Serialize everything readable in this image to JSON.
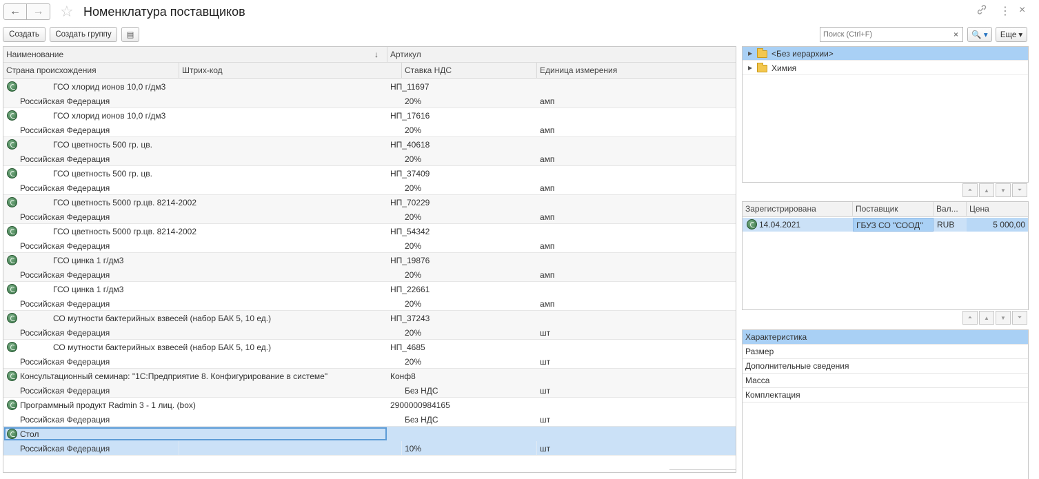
{
  "window": {
    "title": "Номенклатура поставщиков",
    "back_icon": "←",
    "forward_icon": "→",
    "star_icon": "☆",
    "link_icon": "🔗",
    "menu_icon": "⋮",
    "close_icon": "×"
  },
  "toolbar": {
    "create_label": "Создать",
    "create_group_label": "Создать группу",
    "list_icon": "▤",
    "search_placeholder": "Поиск (Ctrl+F)",
    "search_clear": "×",
    "search_btn": "🔍 ▾",
    "more_label": "Еще ▾"
  },
  "table": {
    "headers": {
      "name": "Наименование",
      "sort_arrow": "↓",
      "article": "Артикул",
      "country": "Страна происхождения",
      "barcode": "Штрих-код",
      "vat": "Ставка НДС",
      "unit": "Единица измерения"
    },
    "rows": [
      {
        "name": "ГСО хлорид ионов  10,0 г/дм3",
        "indent": true,
        "article": "НП_11697",
        "country": "Российская Федерация",
        "vat": "20%",
        "unit": "амп"
      },
      {
        "name": "ГСО хлорид ионов  10,0 г/дм3",
        "indent": true,
        "article": "НП_17616",
        "country": "Российская Федерация",
        "vat": "20%",
        "unit": "амп"
      },
      {
        "name": "ГСО цветность  500 гр. цв.",
        "indent": true,
        "article": "НП_40618",
        "country": "Российская Федерация",
        "vat": "20%",
        "unit": "амп"
      },
      {
        "name": "ГСО цветность  500 гр. цв.",
        "indent": true,
        "article": "НП_37409",
        "country": "Российская Федерация",
        "vat": "20%",
        "unit": "амп"
      },
      {
        "name": "ГСО цветность  5000 гр.цв. 8214-2002",
        "indent": true,
        "article": "НП_70229",
        "country": "Российская Федерация",
        "vat": "20%",
        "unit": "амп"
      },
      {
        "name": "ГСО цветность  5000 гр.цв. 8214-2002",
        "indent": true,
        "article": "НП_54342",
        "country": "Российская Федерация",
        "vat": "20%",
        "unit": "амп"
      },
      {
        "name": "ГСО цинка  1 г/дм3",
        "indent": true,
        "article": "НП_19876",
        "country": "Российская Федерация",
        "vat": "20%",
        "unit": "амп"
      },
      {
        "name": "ГСО цинка  1 г/дм3",
        "indent": true,
        "article": "НП_22661",
        "country": "Российская Федерация",
        "vat": "20%",
        "unit": "амп"
      },
      {
        "name": "СО  мутности бактерийных взвесей (набор БАК 5, 10 ед.)",
        "indent": true,
        "article": "НП_37243",
        "country": "Российская Федерация",
        "vat": "20%",
        "unit": "шт"
      },
      {
        "name": "СО  мутности бактерийных взвесей (набор БАК 5, 10 ед.)",
        "indent": true,
        "article": "НП_4685",
        "country": "Российская Федерация",
        "vat": "20%",
        "unit": "шт"
      },
      {
        "name": "Консультационный семинар: \"1С:Предприятие 8. Конфигурирование в системе\"",
        "indent": false,
        "article": "Конф8",
        "country": "Российская Федерация",
        "vat": "Без НДС",
        "unit": "шт"
      },
      {
        "name": "Программный продукт Radmin 3 - 1 лиц. (box)",
        "indent": false,
        "article": "2900000984165",
        "country": "Российская Федерация",
        "vat": "Без НДС",
        "unit": "шт"
      },
      {
        "name": "Стол",
        "indent": false,
        "article": "",
        "country": "Российская Федерация",
        "vat": "10%",
        "unit": "шт",
        "selected": true
      }
    ]
  },
  "tree": {
    "items": [
      {
        "label": "<Без иерархии>",
        "selected": true
      },
      {
        "label": "Химия",
        "selected": false
      }
    ]
  },
  "prices": {
    "headers": {
      "registered": "Зарегистрирована",
      "supplier": "Поставщик",
      "currency": "Вал...",
      "price": "Цена"
    },
    "row": {
      "registered": "14.04.2021",
      "supplier": "ГБУЗ СО \"СООД\"",
      "currency": "RUB",
      "price": "5 000,00"
    }
  },
  "characteristics": {
    "header": "Характеристика",
    "items": [
      "Размер",
      "Дополнительные сведения",
      "Масса",
      "Комплектация"
    ]
  }
}
